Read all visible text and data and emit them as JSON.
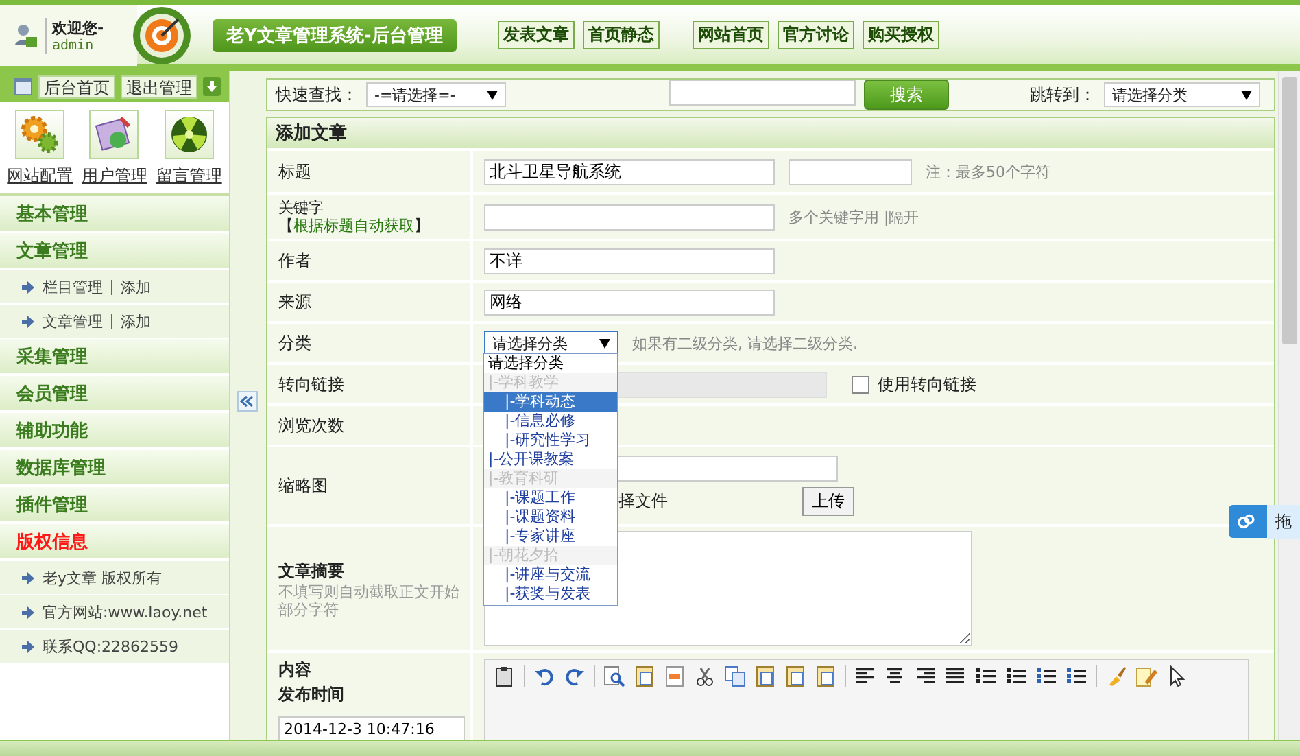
{
  "header": {
    "welcome": "欢迎您-",
    "user": "admin",
    "title": "老Y文章管理系统-后台管理",
    "nav_links": [
      {
        "label": "发表文章"
      },
      {
        "label": "首页静态"
      },
      {
        "label": "网站首页"
      },
      {
        "label": "官方讨论"
      },
      {
        "label": "购买授权"
      }
    ]
  },
  "sidebar": {
    "top_buttons": [
      "后台首页",
      "退出管理"
    ],
    "shortcuts": [
      {
        "label": "网站配置",
        "kind": "gear"
      },
      {
        "label": "用户管理",
        "kind": "notebook"
      },
      {
        "label": "留言管理",
        "kind": "sphere"
      }
    ],
    "menu": [
      {
        "title": "基本管理",
        "color": "#3b7d1e"
      },
      {
        "title": "文章管理",
        "color": "#3b7d1e",
        "items": [
          {
            "label": "栏目管理",
            "action": "添加"
          },
          {
            "label": "文章管理",
            "action": "添加"
          }
        ]
      },
      {
        "title": "采集管理",
        "color": "#3b7d1e"
      },
      {
        "title": "会员管理",
        "color": "#3b7d1e"
      },
      {
        "title": "辅助功能",
        "color": "#3b7d1e"
      },
      {
        "title": "数据库管理",
        "color": "#3b7d1e"
      },
      {
        "title": "插件管理",
        "color": "#3b7d1e"
      },
      {
        "title": "版权信息",
        "color": "#ff1a1a",
        "items": [
          {
            "label": "老y文章 版权所有"
          },
          {
            "label": "官方网站:www.laoy.net"
          },
          {
            "label": "联系QQ:22862559"
          }
        ]
      }
    ]
  },
  "search_bar": {
    "quick_find_label": "快速查找：",
    "quick_find_value": "-=请选择=-",
    "search_button": "搜索",
    "jump_label": "跳转到：",
    "jump_value": "请选择分类"
  },
  "form": {
    "title": "添加文章",
    "title_row": {
      "label": "标题",
      "value": "北斗卫星导航系统",
      "note": "注：最多50个字符"
    },
    "keywords_row": {
      "label": "关键字【",
      "link": "根据标题自动获取",
      "label_end": "】",
      "note": "多个关键字用 |隔开"
    },
    "author_row": {
      "label": "作者",
      "value": "不详"
    },
    "source_row": {
      "label": "来源",
      "value": "网络"
    },
    "category_row": {
      "label": "分类",
      "value": "请选择分类",
      "note": "如果有二级分类, 请选择二级分类.",
      "expanded": true,
      "options": [
        {
          "label": "请选择分类",
          "disabled": false,
          "selected": true
        },
        {
          "label": "|-学科教学",
          "disabled": true,
          "selected": false,
          "children": [
            {
              "label": "|-学科动态",
              "highlighted": true
            },
            {
              "label": "|-信息必修",
              "highlighted": false
            },
            {
              "label": "|-研究性学习",
              "highlighted": false
            }
          ]
        },
        {
          "label": "|-公开课教案",
          "disabled": false,
          "selected": false
        },
        {
          "label": "|-教育科研",
          "disabled": true,
          "selected": false,
          "children": [
            {
              "label": "|-课题工作",
              "highlighted": false
            },
            {
              "label": "|-课题资料",
              "highlighted": false
            },
            {
              "label": "|-专家讲座",
              "highlighted": false
            }
          ]
        },
        {
          "label": "|-朝花夕拾",
          "disabled": true,
          "selected": false,
          "children": [
            {
              "label": "|-讲座与交流",
              "highlighted": false
            },
            {
              "label": "|-获奖与发表",
              "highlighted": false
            }
          ]
        }
      ]
    },
    "redirect_row": {
      "label": "转向链接",
      "disabled": true,
      "checkbox_label": "使用转向链接",
      "checked": false
    },
    "views_row": {
      "label": "浏览次数"
    },
    "thumbnail_row": {
      "label": "缩略图",
      "file_button": "择文件",
      "upload_button": "上传"
    },
    "summary_row": {
      "label": "文章摘要",
      "hint": "不填写则自动截取正文开始部分字符"
    },
    "content_row": {
      "label": "内容",
      "time_label": "发布时间",
      "time_value": "2014-12-3 10:47:16"
    }
  },
  "float_widget": {
    "label": "拖"
  }
}
